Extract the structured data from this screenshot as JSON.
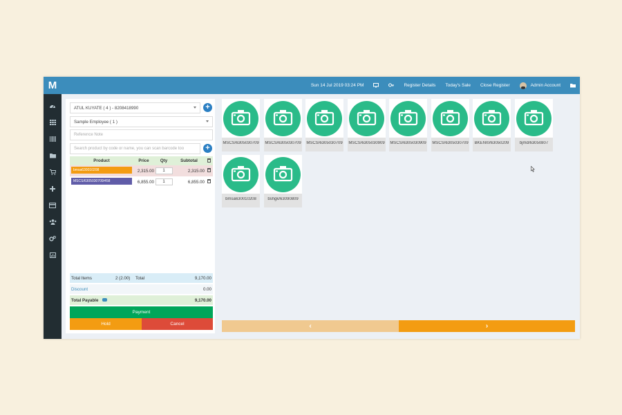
{
  "app": {
    "logo": "M"
  },
  "topbar": {
    "datetime": "Sun 14 Jul 2019 03:24 PM",
    "monitor_icon": "desktop-icon",
    "keys_icon": "key-icon",
    "register_details": "Register Details",
    "todays_sale": "Today's Sale",
    "close_register": "Close Register",
    "user": "Admin Account",
    "folder_icon": "folder-icon"
  },
  "sidebar": {
    "icons": [
      "dashboard-icon",
      "grid-icon",
      "barcode-icon",
      "folder-icon",
      "cart-icon",
      "plus-icon",
      "credit-card-icon",
      "users-icon",
      "cogs-icon",
      "chart-icon"
    ]
  },
  "customer": {
    "value": "ATUL KUYATE ( 4 ) - 8208418990"
  },
  "employee": {
    "value": "Sample Employee ( 1 )"
  },
  "reference": {
    "placeholder": "Reference Note"
  },
  "search": {
    "placeholder": "Search product by code or name, you can scan barcode too"
  },
  "table": {
    "headers": {
      "product": "Product",
      "price": "Price",
      "qty": "Qty",
      "subtotal": "Subtotal"
    },
    "rows": [
      {
        "product": "bmsa630010208",
        "price": "2,315.00",
        "qty": "1",
        "subtotal": "2,315.00",
        "color": "#f39c12"
      },
      {
        "product": "MSCS/6305030709/458",
        "price": "6,855.00",
        "qty": "1",
        "subtotal": "6,855.00",
        "color": "#605ca8"
      }
    ]
  },
  "totals": {
    "items_label": "Total Items",
    "items_value": "2 (2.00)",
    "total_label": "Total",
    "total_value": "9,170.00",
    "discount_label": "Discount",
    "discount_value": "0.00",
    "payable_label": "Total Payable",
    "payable_value": "9,170.00"
  },
  "buttons": {
    "payment": "Payment",
    "hold": "Hold",
    "cancel": "Cancel"
  },
  "products": [
    "MSCS/6305030709",
    "MSCS/6305030709",
    "MSCS/6305030709",
    "MSCS/6305030909",
    "MSCS/6305030909",
    "MSCS/6305030709",
    "BKENI0/63050209",
    "bjmd/63050807",
    "bmsa630010208",
    "bshgk/63090809"
  ],
  "pager": {
    "prev": "‹",
    "next": "›"
  }
}
